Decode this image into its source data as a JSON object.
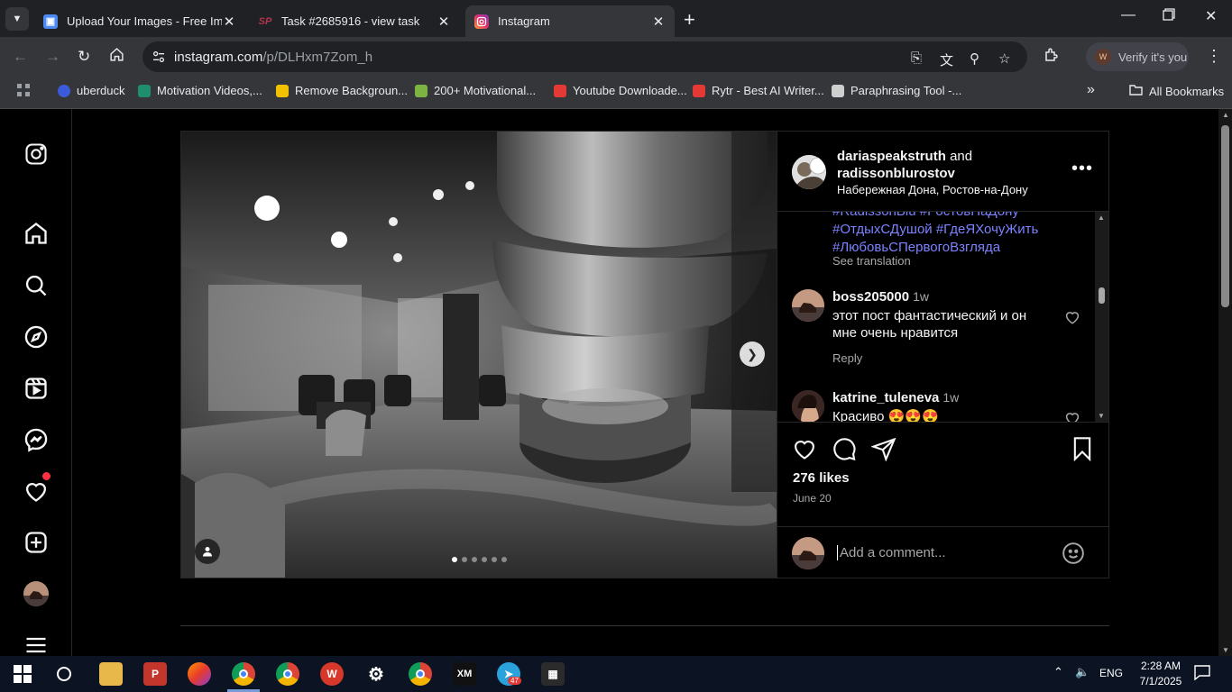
{
  "browser": {
    "tabs": [
      {
        "title": "Upload Your Images - Free Imag",
        "icon": "image-upload-favicon"
      },
      {
        "title": "Task #2685916 - view task",
        "icon": "sp-favicon"
      },
      {
        "title": "Instagram",
        "icon": "instagram-favicon",
        "active": true
      }
    ],
    "url_host": "instagram.com",
    "url_path": "/p/DLHxm7Zom_h",
    "verify_label": "Verify it's you",
    "profile_initial": "W",
    "bookmarks": [
      {
        "label": "uberduck",
        "color": "#3b5bdb"
      },
      {
        "label": "Motivation Videos,...",
        "color": "#1e8e6e"
      },
      {
        "label": "Remove Backgroun...",
        "color": "#f2c200"
      },
      {
        "label": "200+ Motivational...",
        "color": "#7cb342"
      },
      {
        "label": "Youtube Downloade...",
        "color": "#e53935"
      },
      {
        "label": "Rytr - Best AI Writer...",
        "color": "#e53935"
      },
      {
        "label": "Paraphrasing Tool -...",
        "color": "#cfcfcf"
      }
    ],
    "all_bookmarks": "All Bookmarks"
  },
  "post": {
    "author_line1": "dariaspeakstruth",
    "author_and": "and",
    "author_line2": "radissonblurostov",
    "location": "Набережная Дона, Ростов-на-Дону",
    "hashtags_line0": "#RadissonBlu #РостовНаДону",
    "hashtags_line1": "#ОтдыхСДушой #ГдеЯХочуЖить",
    "hashtags_line2": "#ЛюбовьСПервогоВзгляда",
    "see_translation": "See translation",
    "comments": [
      {
        "user": "boss205000",
        "time": "1w",
        "text": "этот пост фантастический и он мне очень нравится",
        "reply": "Reply"
      },
      {
        "user": "katrine_tuleneva",
        "time": "1w",
        "text": "Красиво 😍😍😍",
        "reply": ""
      }
    ],
    "likes": "276 likes",
    "date": "June 20",
    "add_comment_placeholder": "Add a comment...",
    "carousel_count": 6,
    "carousel_active": 0
  },
  "taskbar": {
    "lang": "ENG",
    "time": "2:28 AM",
    "date": "7/1/2025",
    "telegram_badge": "47"
  }
}
